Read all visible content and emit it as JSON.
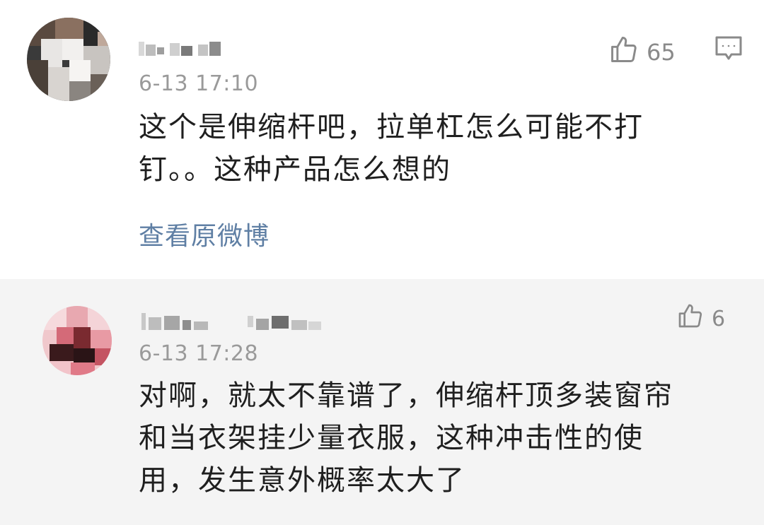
{
  "comments": [
    {
      "time": "6-13 17:10",
      "likes": "65",
      "text_lines": [
        "这个是伸缩杆吧，拉单杠怎么可能不打",
        "钉。。这种产品怎么想的"
      ],
      "view_original": "查看原微博"
    },
    {
      "time": "6-13 17:28",
      "likes": "6",
      "text_lines": [
        "对啊，就太不靠谱了，伸缩杆顶多装窗帘",
        "和当衣架挂少量衣服，这种冲击性的使",
        "用，发生意外概率太大了"
      ]
    }
  ],
  "icons": {
    "like": "thumbs-up-icon",
    "reply": "comment-bubble-icon"
  },
  "colors": {
    "link": "#5f7fa4",
    "meta": "#9a9a9a",
    "body_text": "#1f1f1f",
    "reply_bg": "#f4f4f4"
  }
}
